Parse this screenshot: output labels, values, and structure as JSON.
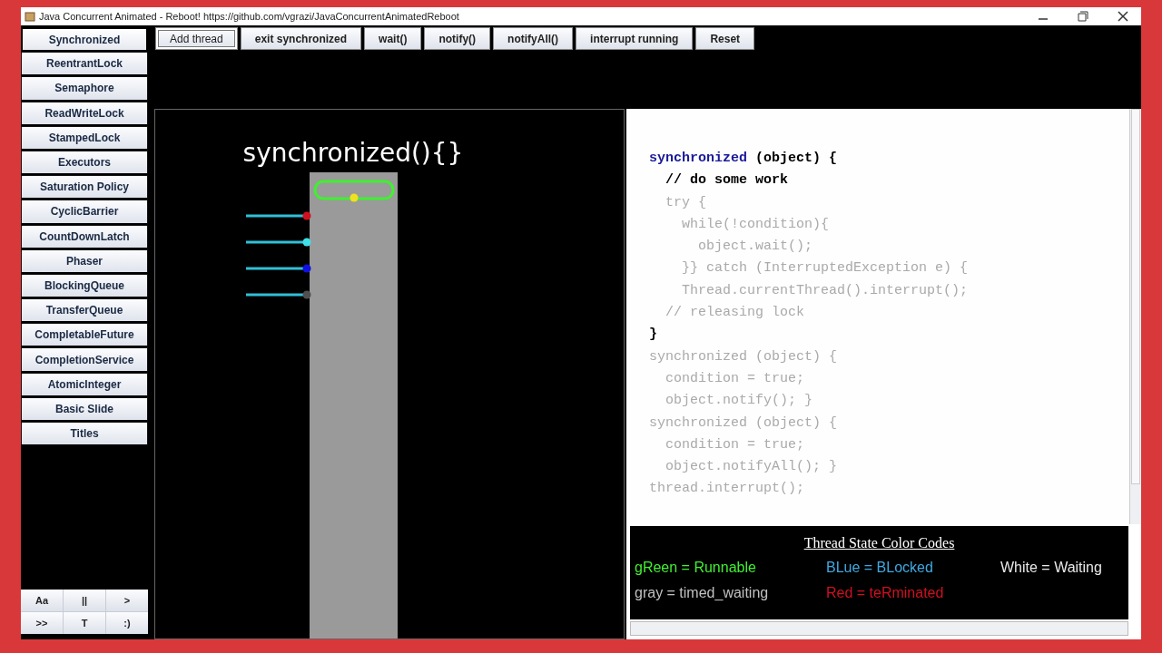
{
  "window": {
    "title": "Java Concurrent Animated - Reboot! https://github.com/vgrazi/JavaConcurrentAnimatedReboot"
  },
  "sidebar": {
    "items": [
      {
        "label": "Synchronized",
        "selected": true
      },
      {
        "label": "ReentrantLock",
        "selected": false
      },
      {
        "label": "Semaphore",
        "selected": false
      },
      {
        "label": "ReadWriteLock",
        "selected": false
      },
      {
        "label": "StampedLock",
        "selected": false
      },
      {
        "label": "Executors",
        "selected": false
      },
      {
        "label": "Saturation Policy",
        "selected": false
      },
      {
        "label": "CyclicBarrier",
        "selected": false
      },
      {
        "label": "CountDownLatch",
        "selected": false
      },
      {
        "label": "Phaser",
        "selected": false
      },
      {
        "label": "BlockingQueue",
        "selected": false
      },
      {
        "label": "TransferQueue",
        "selected": false
      },
      {
        "label": "CompletableFuture",
        "selected": false
      },
      {
        "label": "CompletionService",
        "selected": false
      },
      {
        "label": "AtomicInteger",
        "selected": false
      },
      {
        "label": "Basic Slide",
        "selected": false
      },
      {
        "label": "Titles",
        "selected": false
      }
    ],
    "controls": [
      "Aa",
      "||",
      ">",
      ">>",
      "T",
      ":)"
    ]
  },
  "toolbar": {
    "buttons": [
      {
        "label": "Add thread",
        "focused": true
      },
      {
        "label": "exit synchronized",
        "focused": false
      },
      {
        "label": "wait()",
        "focused": false
      },
      {
        "label": "notify()",
        "focused": false
      },
      {
        "label": "notifyAll()",
        "focused": false
      },
      {
        "label": "interrupt running",
        "focused": false
      },
      {
        "label": "Reset",
        "focused": false
      }
    ]
  },
  "animation": {
    "title": "synchronized(){}",
    "inside": [
      {
        "color": "#f0e020"
      }
    ],
    "waiting": [
      {
        "color": "#d01020"
      },
      {
        "color": "#40e0e8"
      },
      {
        "color": "#1010e0"
      },
      {
        "color": "#505050"
      }
    ]
  },
  "code": {
    "lines": [
      {
        "keyword": "synchronized",
        "text": " (object) {",
        "active": true
      },
      {
        "text": "  // do some work",
        "active": true
      },
      {
        "text": "  try {",
        "active": false
      },
      {
        "text": "    while(!condition){",
        "active": false
      },
      {
        "text": "      object.wait();",
        "active": false
      },
      {
        "text": "    }} catch (InterruptedException e) {",
        "active": false
      },
      {
        "text": "    Thread.currentThread().interrupt();",
        "active": false
      },
      {
        "text": "  // releasing lock",
        "active": false
      },
      {
        "text": "}",
        "active": true
      },
      {
        "text": "synchronized (object) {",
        "active": false
      },
      {
        "text": "  condition = true;",
        "active": false
      },
      {
        "text": "  object.notify(); }",
        "active": false
      },
      {
        "text": "synchronized (object) {",
        "active": false
      },
      {
        "text": "  condition = true;",
        "active": false
      },
      {
        "text": "  object.notifyAll(); }",
        "active": false
      },
      {
        "text": "thread.interrupt();",
        "active": false
      }
    ]
  },
  "legend": {
    "title": "Thread State Color Codes",
    "items": [
      {
        "text": "gReen = Runnable",
        "color": "#40f030"
      },
      {
        "text": "BLue = BLocked",
        "color": "#40a8e0"
      },
      {
        "text": "White = Waiting",
        "color": "#e8e8e8"
      },
      {
        "text": "gray = timed_waiting",
        "color": "#c0c0c0"
      },
      {
        "text": "Red = teRminated",
        "color": "#d01020"
      }
    ]
  }
}
